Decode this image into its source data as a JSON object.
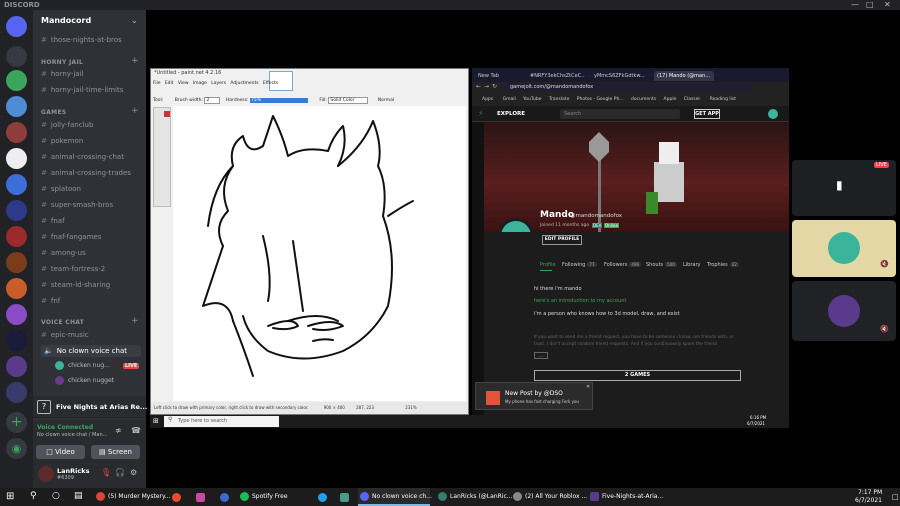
{
  "window": {
    "title": "DISCORD"
  },
  "server": {
    "name": "Mandocord"
  },
  "channels": {
    "top": [
      {
        "name": "those-nights-at-bros"
      }
    ],
    "categories": [
      {
        "name": "HORNY JAIL",
        "items": [
          "horny-jail",
          "horny-jail-time-limits"
        ]
      },
      {
        "name": "GAMES",
        "items": [
          "jolly-fanclub",
          "pokemon",
          "animal-crossing-chat",
          "animal-crossing-trades",
          "splatoon",
          "super-smash-bros",
          "fnaf",
          "fnaf-fangames",
          "among-us",
          "team-fortress-2",
          "steam-id-sharing",
          "fnf"
        ]
      }
    ],
    "voice_category": {
      "name": "VOICE CHAT",
      "text_channel": "epic-music",
      "voice_channel": "No clown voice chat",
      "users": [
        "chicken nug...",
        "chicken nugget"
      ],
      "live_badge": "LIVE"
    }
  },
  "activity": {
    "title": "Five Nights at Arias Re..."
  },
  "voice": {
    "status": "Voice Connected",
    "channel": "No clown voice chat / Man...",
    "video_label": "Video",
    "screen_label": "Screen"
  },
  "user": {
    "name": "LanRicks",
    "tag": "#6309"
  },
  "paint": {
    "title": "*Untitled - paint.net 4.2.16",
    "menus": [
      "File",
      "Edit",
      "View",
      "Image",
      "Layers",
      "Adjustments",
      "Effects"
    ],
    "toolbar": {
      "tool_label": "Tool:",
      "brush_width_label": "Brush width:",
      "brush_width": "2",
      "hardness_label": "Hardness:",
      "hardness": "75%",
      "fill_label": "Fill:",
      "fill": "Solid Color",
      "blend": "Normal"
    },
    "status": "Left click to draw with primary color, right click to draw with secondary color.",
    "size": "900 × 400",
    "coords": "287, 223",
    "zoom": "231%"
  },
  "browser": {
    "tabs": [
      "New Tab",
      "#NRFY3ekChsZtCeC...",
      "yMmcS6ZFkGdtkw...",
      "(17) Mando (@man..."
    ],
    "url": "gamejolt.com/@mandomandofox",
    "bookmarks": [
      "Apps",
      "Gmail",
      "YouTube",
      "Translate",
      "Photos - Google Ph...",
      "documents",
      "Apple",
      "Classer",
      "Reading list"
    ],
    "nav": {
      "explore": "EXPLORE",
      "search_placeholder": "Search",
      "get_app": "GET APP"
    },
    "profile": {
      "name": "Mando",
      "handle": "@mandomandofox",
      "joined": "Joined 11 months ago",
      "badge_dev": "DEV",
      "badge_online": "Online",
      "edit_button": "EDIT PROFILE",
      "tabs": [
        {
          "label": "Profile",
          "count": ""
        },
        {
          "label": "Following",
          "count": "77"
        },
        {
          "label": "Followers",
          "count": "496"
        },
        {
          "label": "Shouts",
          "count": "500"
        },
        {
          "label": "Library",
          "count": ""
        },
        {
          "label": "Trophies",
          "count": "22"
        }
      ],
      "bio": [
        "hi there i'm mando",
        "here's an introduction to my account",
        "i'm a person who knows how to 3d model, draw, and exist",
        "If you want to send me a friend request, you have to be someone i know, am friends with, or",
        "trust. I don't accept random friend requests. And if you continuously spam the friend"
      ],
      "more_button": "...",
      "games_button": "2 GAMES"
    }
  },
  "toast": {
    "title": "New Post by @DSO",
    "body": "My phone has fast charging Fork you"
  },
  "inner_taskbar": {
    "search_placeholder": "Type here to search",
    "time": "6:16 PM",
    "date": "6/7/2021"
  },
  "right_panel": {
    "live_badge": "LIVE"
  },
  "taskbar": {
    "items": [
      "(5) Murder Mystery...",
      "Spotify Free",
      "No clown voice ch...",
      "LanRicks (@LanRic...",
      "(2) All Your Roblox ...",
      "Five-Nights-at-Aria..."
    ],
    "time": "7:17 PM",
    "date": "6/7/2021"
  }
}
